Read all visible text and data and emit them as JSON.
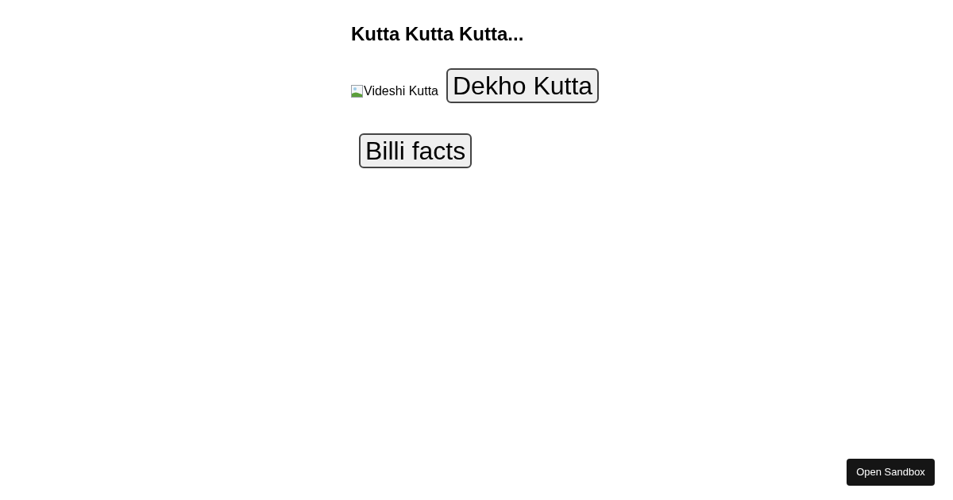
{
  "heading": "Kutta Kutta Kutta...",
  "image": {
    "alt": "Videshi Kutta"
  },
  "buttons": [
    "Dekho Kutta",
    "Billi facts"
  ],
  "sandbox_button": "Open Sandbox"
}
